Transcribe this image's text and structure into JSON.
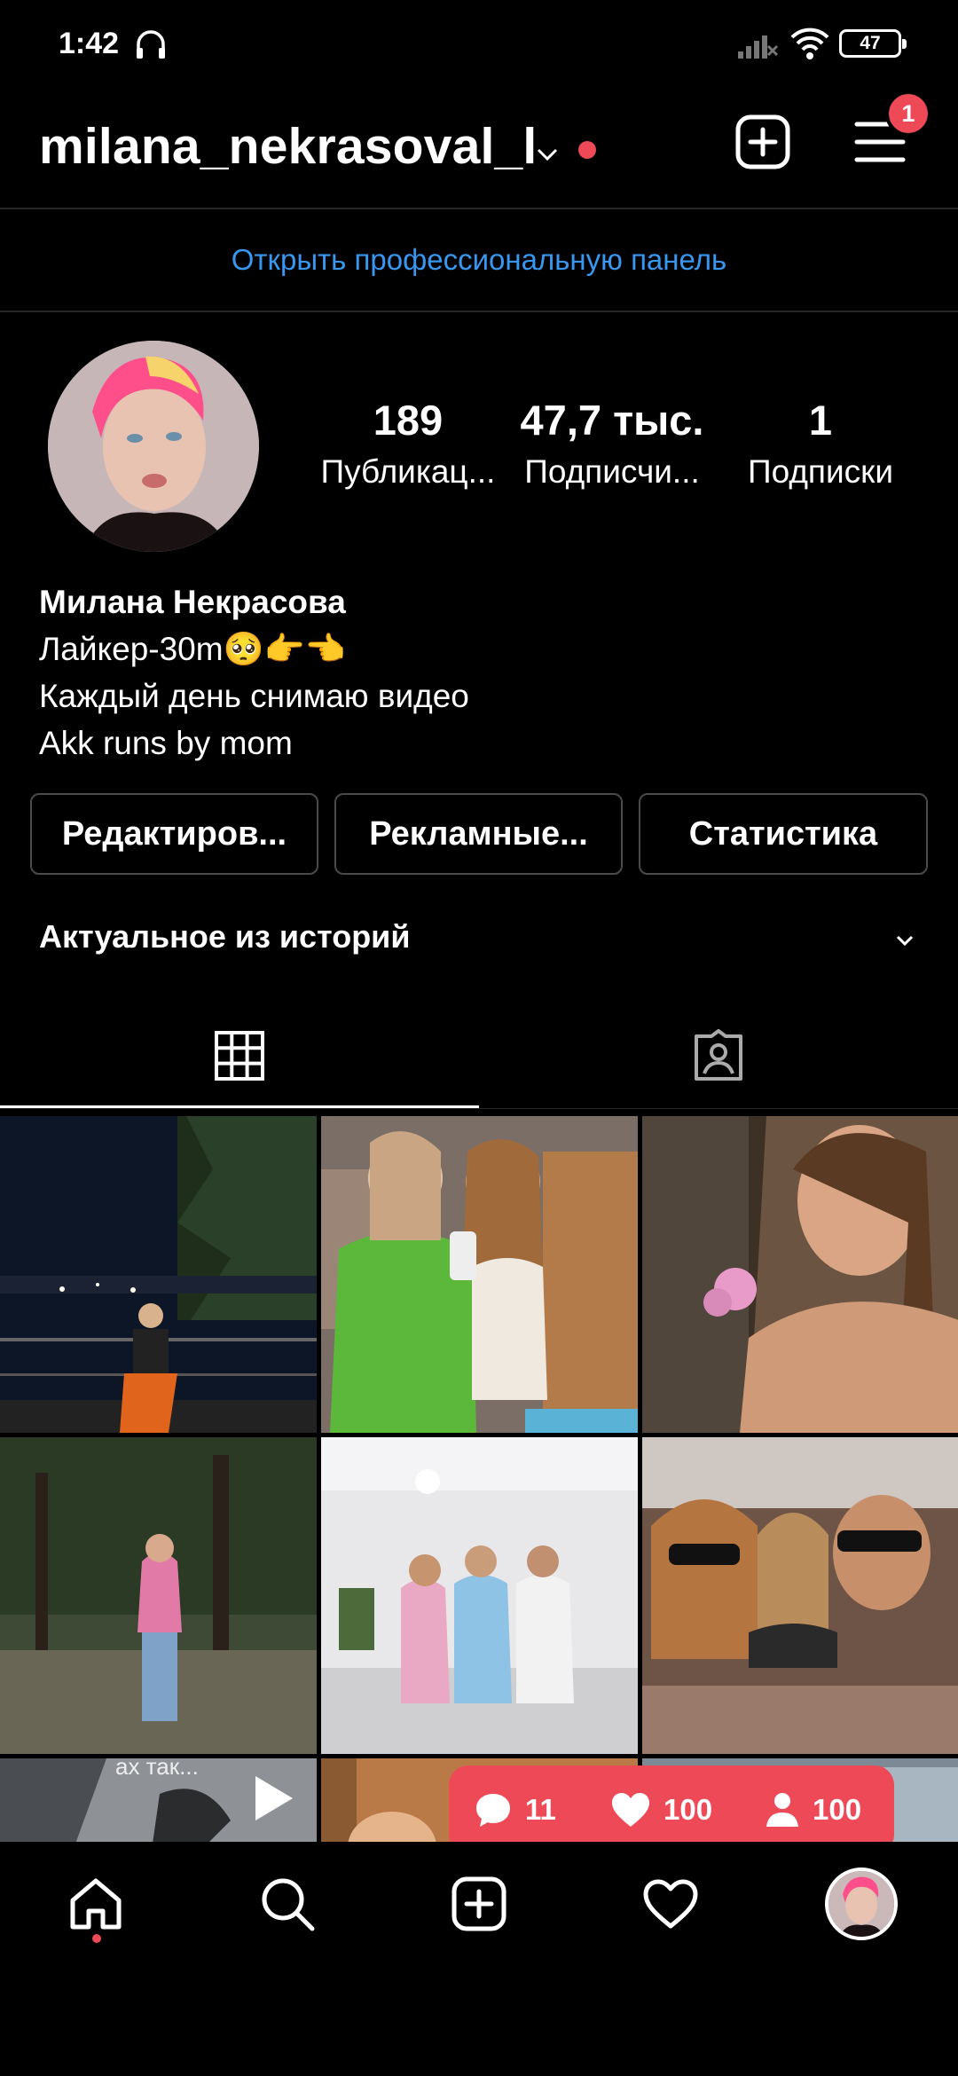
{
  "status_bar": {
    "time": "1:42",
    "battery": "47"
  },
  "header": {
    "username": "milana_nekrasoval_l",
    "menu_badge": "1"
  },
  "pro_panel": {
    "label": "Открыть профессиональную панель"
  },
  "profile": {
    "stats": [
      {
        "value": "189",
        "label": "Публикац..."
      },
      {
        "value": "47,7 тыс.",
        "label": "Подписчи..."
      },
      {
        "value": "1",
        "label": "Подписки"
      }
    ],
    "name": "Милана Некрасова",
    "bio_lines": [
      "Лайкер-30m🥺👉👈",
      "Каждый день снимаю видео",
      "Akk runs by mom"
    ]
  },
  "actions": {
    "edit": "Редактиров...",
    "ads": "Рекламные...",
    "stats": "Статистика"
  },
  "highlights": {
    "label": "Актуальное из историй"
  },
  "grid": {
    "row3_caption": "ах так..."
  },
  "activity": {
    "comments": "11",
    "likes": "100",
    "followers": "100"
  },
  "colors": {
    "accent_blue": "#3897f0",
    "notification_red": "#ed4956",
    "background": "#000000"
  }
}
